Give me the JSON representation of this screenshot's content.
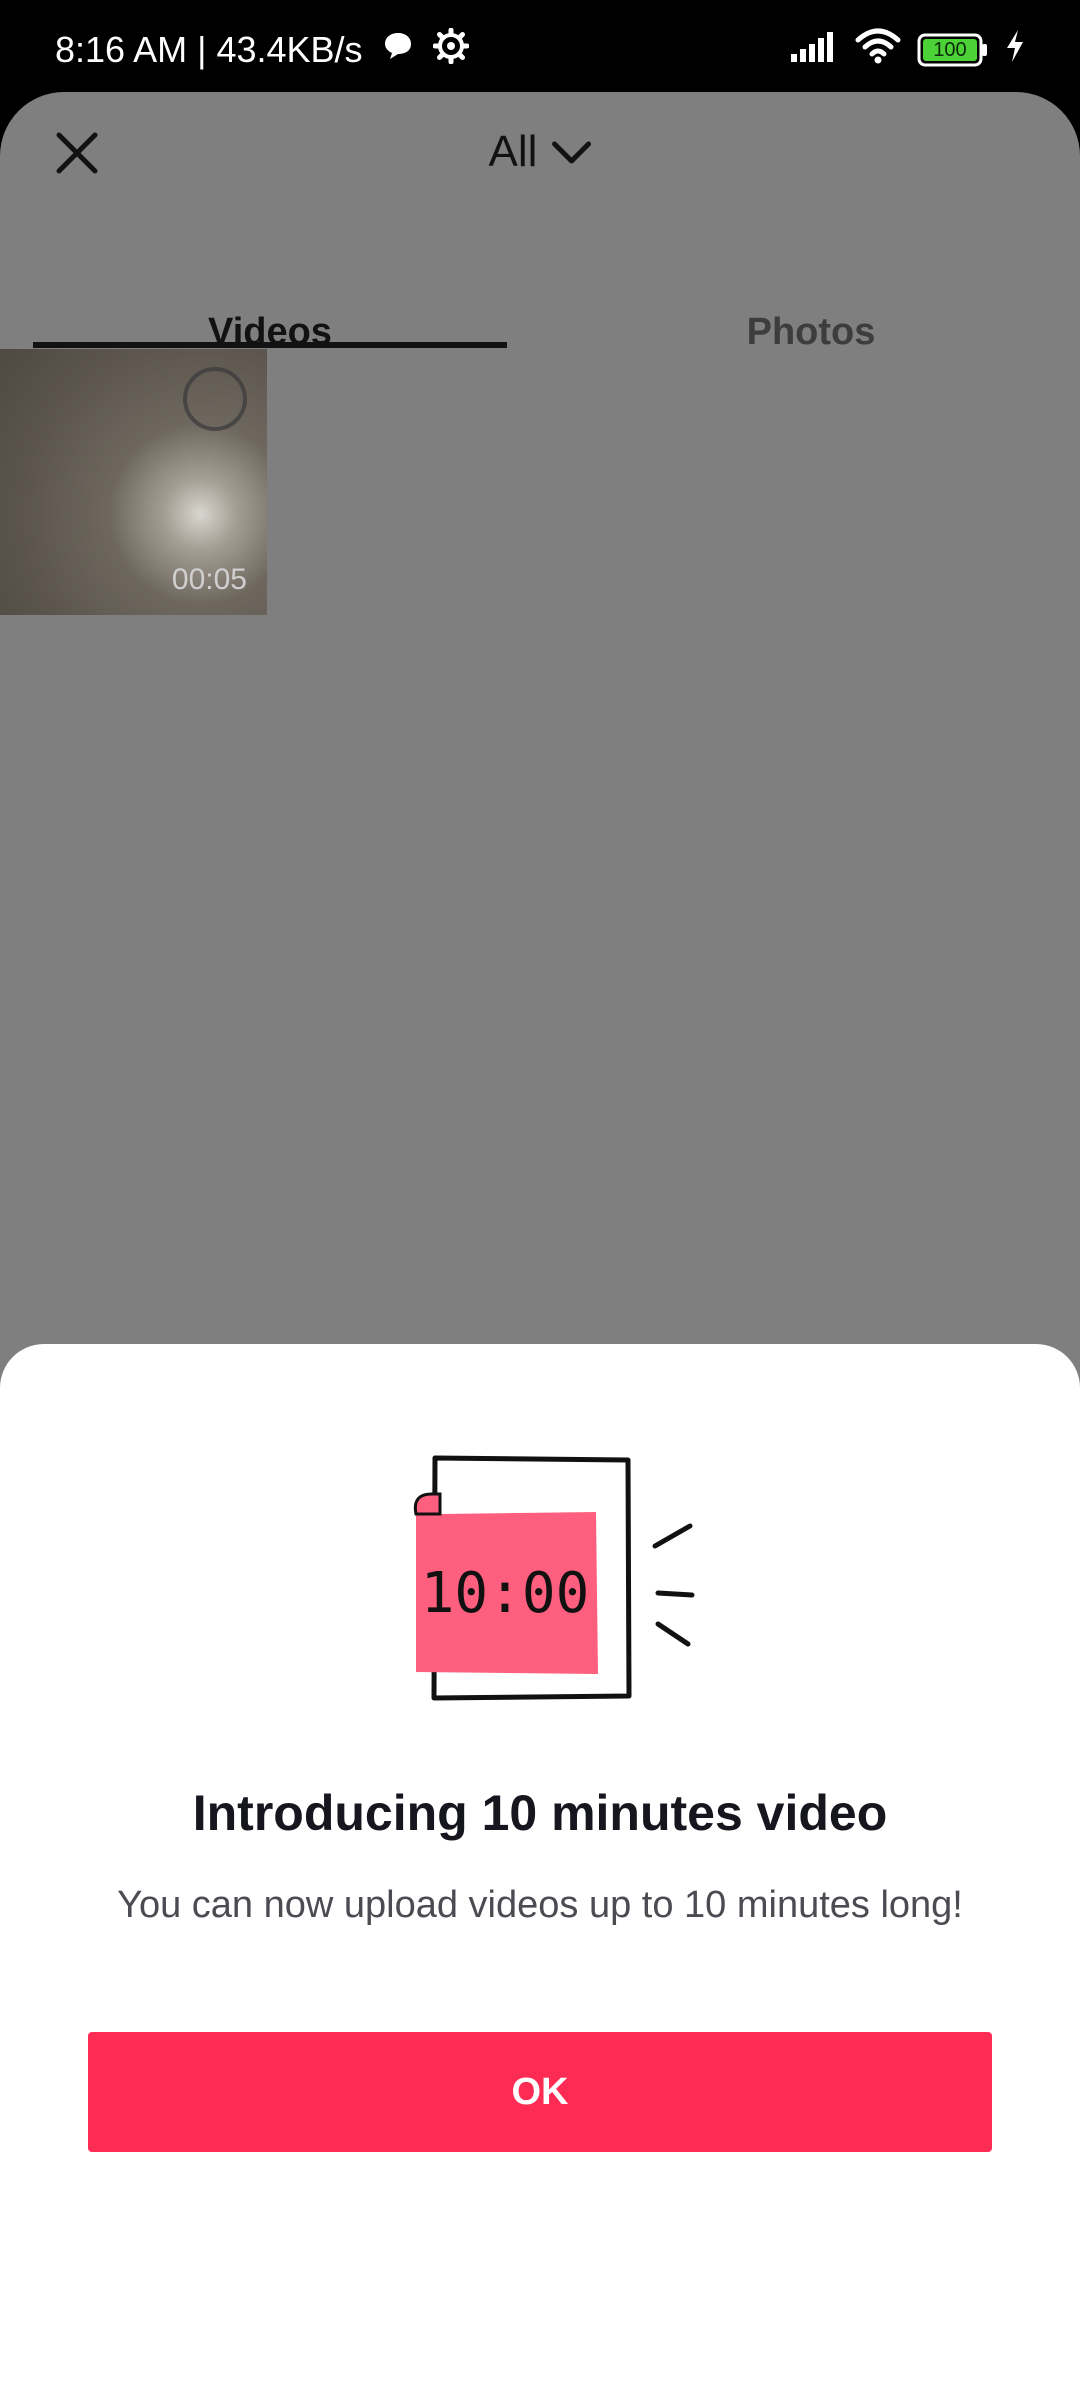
{
  "status_bar": {
    "time_speed": "8:16 AM | 43.4KB/s",
    "battery": "100"
  },
  "topbar": {
    "album_label": "All"
  },
  "tabs": [
    {
      "label": "Videos",
      "active": true
    },
    {
      "label": "Photos",
      "active": false
    }
  ],
  "media": [
    {
      "duration": "00:05"
    }
  ],
  "dialog": {
    "illustration_time": "10:00",
    "title": "Introducing 10 minutes video",
    "subtitle": "You can now upload videos up to 10 minutes long!",
    "ok_label": "OK"
  },
  "colors": {
    "accent": "#fe2c55",
    "illustration_pink": "#fe5f7f",
    "dim_overlay": "#7f7f7f"
  }
}
